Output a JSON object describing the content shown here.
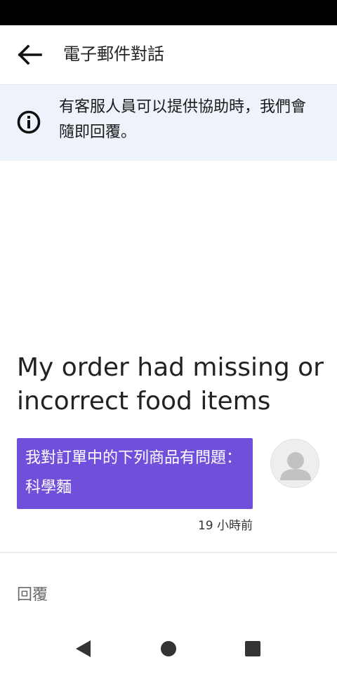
{
  "header": {
    "title": "電子郵件對話",
    "back_icon": "arrow-left-icon"
  },
  "banner": {
    "icon": "info-icon",
    "text": "有客服人員可以提供協助時，我們會隨即回覆。"
  },
  "conversation": {
    "subject": "My order had missing or incorrect food items",
    "message": "我對訂單中的下列商品有問題：科學麵",
    "timestamp": "19 小時前",
    "bubble_color": "#7050db"
  },
  "reply": {
    "label": "回覆"
  },
  "navigation": {
    "back_icon": "triangle-back-icon",
    "home_icon": "circle-home-icon",
    "recents_icon": "square-recents-icon"
  }
}
